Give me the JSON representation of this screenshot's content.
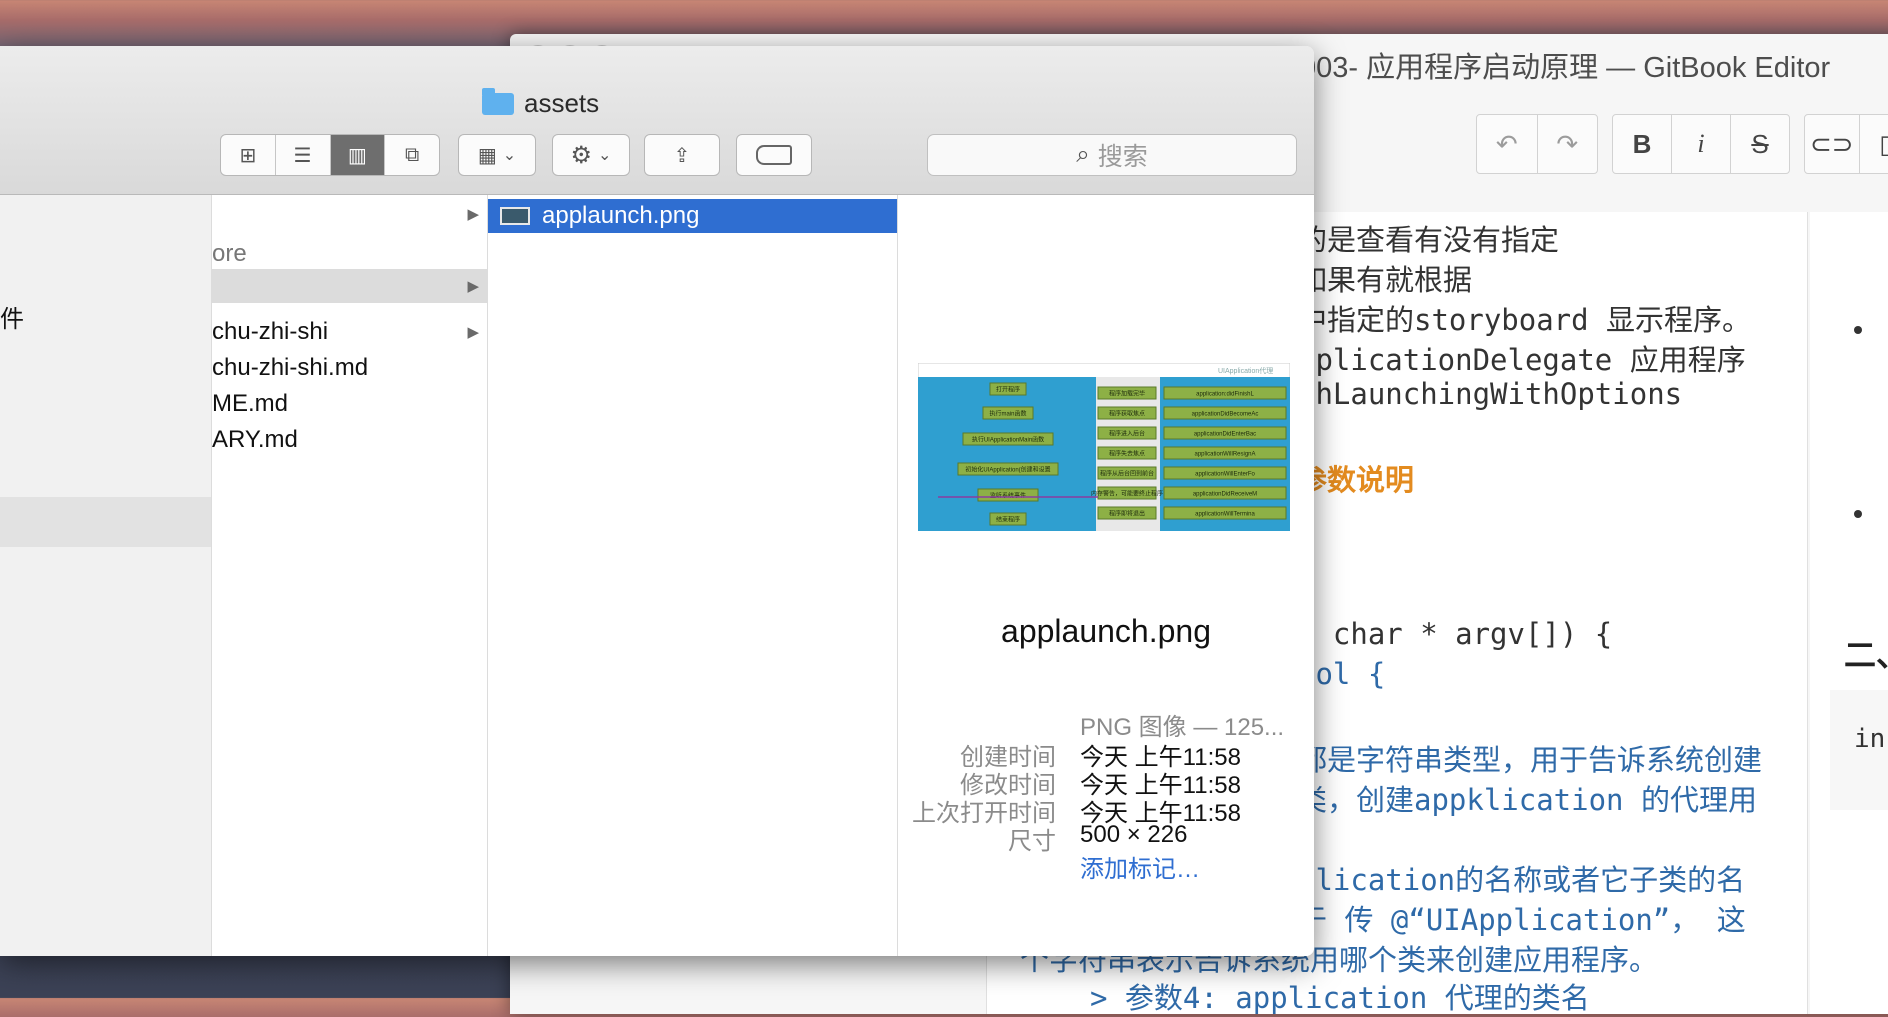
{
  "editor": {
    "title": "003- 应用程序启动原理 — GitBook Editor",
    "toolbar": {
      "bold": "B",
      "italic": "i",
      "strike": "S"
    },
    "lines": [
      "的是查看有没有指定",
      "如果有就根据",
      "中指定的storyboard 显示程序。",
      "pplicationDelegate 应用程序",
      "shLaunchingWithOptions",
      "参数说明",
      ", char * argv[]) {",
      "ool {",
      "都是字符串类型，用于告诉系统创建",
      "类，创建appklication 的代理用",
      "plication的名称或者它子类的名",
      "于 传 @“UIApplication”， 这",
      "个字符串表示告诉系统用哪个类来创建应用程序。",
      "> 参数4: application 代理的类名"
    ],
    "right_heading": "二、",
    "right_code": "in"
  },
  "finder": {
    "title": "assets",
    "search_placeholder": "搜索",
    "sidebar": {
      "item": "件"
    },
    "column1": [
      {
        "label": "",
        "arrow": true
      },
      {
        "label": "ore",
        "arrow": false
      },
      {
        "label": "",
        "arrow": true
      },
      {
        "label": "chu-zhi-shi",
        "arrow": true
      },
      {
        "label": "chu-zhi-shi.md",
        "arrow": false
      },
      {
        "label": "ME.md",
        "arrow": false
      },
      {
        "label": "ARY.md",
        "arrow": false
      }
    ],
    "column2": [
      {
        "label": "applaunch.png"
      }
    ],
    "preview": {
      "name": "applaunch.png",
      "kind": "PNG 图像 — 125...",
      "created_label": "创建时间",
      "created": "今天 上午11:58",
      "modified_label": "修改时间",
      "modified": "今天 上午11:58",
      "opened_label": "上次打开时间",
      "opened": "今天 上午11:58",
      "size_label": "尺寸",
      "size": "500 × 226",
      "add_tags": "添加标记…",
      "diagram": {
        "right_title": "UIApplication代理",
        "left_boxes": [
          "打开程序",
          "执行main函数",
          "执行UIApplicationMain函数",
          "初始化UIApplication(创建和设置代理对象，开启事件循环)",
          "监听系统事件",
          "结束程序"
        ],
        "mid_boxes": [
          "程序加载完毕",
          "程序获取焦点",
          "程序进入后台",
          "程序失去焦点",
          "程序从后台回到前台",
          "内存警告，可能要终止程序",
          "程序即将退出"
        ],
        "right_boxes": [
          "application:didFinishLaunchingWithOptions:",
          "applicationDidBecomeActive:",
          "applicationDidEnterBackground:",
          "applicationWillResignActive:",
          "applicationWillEnterForeground:",
          "applicationDidReceiveMemoryWarning:",
          "applicationWillTerminate:"
        ]
      }
    }
  }
}
